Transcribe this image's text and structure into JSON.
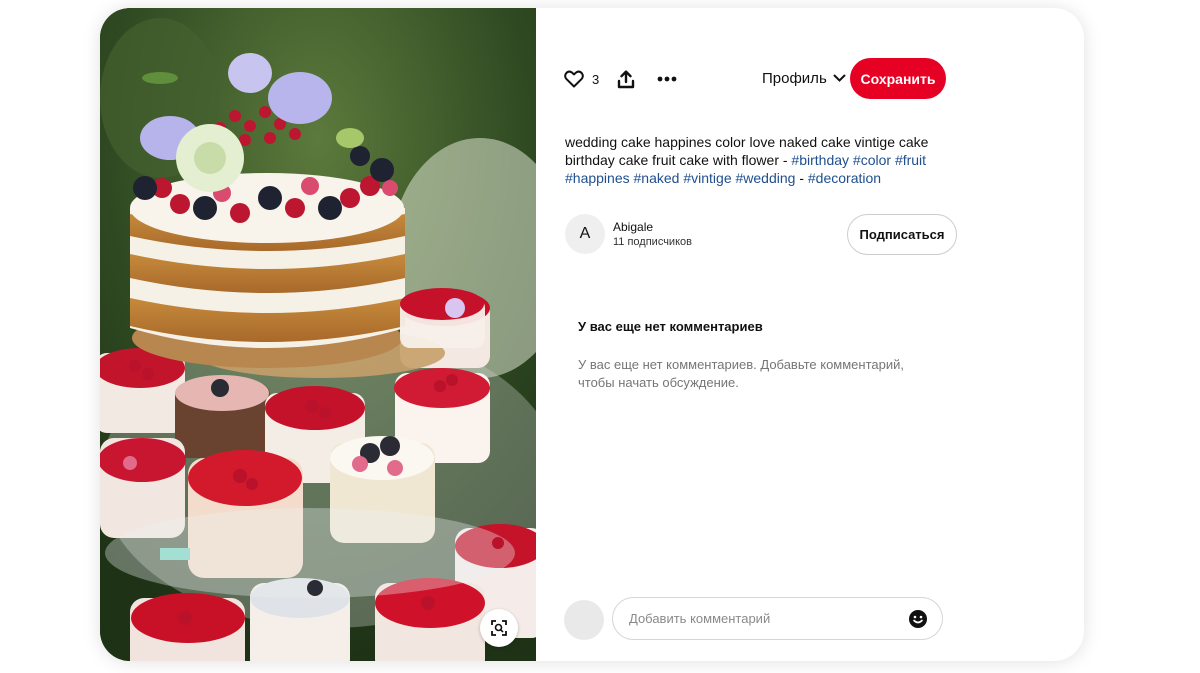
{
  "pin": {
    "like_count": "3",
    "profile_label": "Профиль",
    "save_label": "Сохранить",
    "description": {
      "text": "wedding cake happines color love naked cake vintige cake birthday cake fruit cake with flower -",
      "tags_line1": [
        "#birthday",
        "#color",
        "#fruit"
      ],
      "tags_line2": [
        "#happines",
        "#naked",
        "#vintige",
        "#wedding"
      ],
      "separator": "-",
      "last_tag": "#decoration"
    }
  },
  "author": {
    "initial": "A",
    "name": "Abigale",
    "followers": "11 подписчиков",
    "follow_label": "Подписаться"
  },
  "comments": {
    "title": "У вас еще нет комментариев",
    "empty_text": "У вас еще нет комментариев. Добавьте комментарий, чтобы начать обсуждение.",
    "input_placeholder": "Добавить комментарий"
  },
  "icons": {
    "like": "heart-icon",
    "share": "share-icon",
    "more": "more-icon",
    "dropdown": "chevron-down-icon",
    "visual_search": "visual-search-icon",
    "emoji": "emoji-icon"
  },
  "colors": {
    "save_button": "#e60023",
    "hashtag": "#1f4f8f"
  }
}
